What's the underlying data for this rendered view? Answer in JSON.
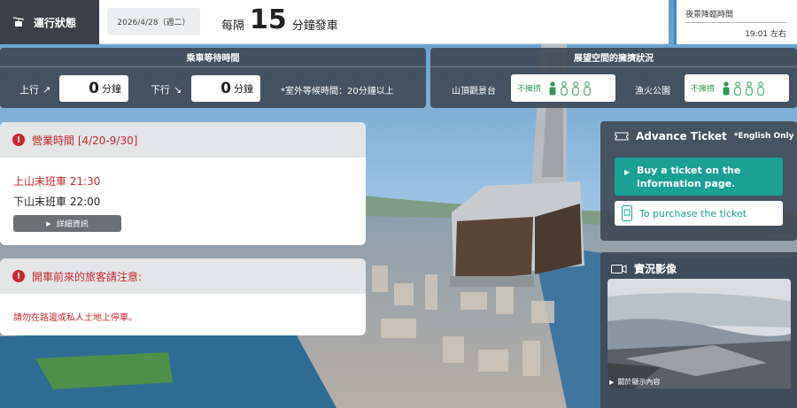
{
  "status": {
    "tag_label": "運行狀態",
    "date": "2026/4/28（週二）",
    "interval_prefix": "每隔",
    "interval_value": "15",
    "interval_suffix": "分鐘發車"
  },
  "night_view": {
    "label": "夜景降臨時間",
    "time": "19:01 左右"
  },
  "wait_time": {
    "title": "乘車等待時間",
    "up_label": "上行",
    "up_value": "0",
    "down_label": "下行",
    "down_value": "0",
    "unit": "分鐘",
    "outdoor_note": "*室外等候時間：20分鐘以上"
  },
  "crowd": {
    "title": "展望空間的擁擠狀況",
    "items": [
      {
        "place": "山頂觀景台",
        "status": "不擁擠",
        "level": 1,
        "max": 4
      },
      {
        "place": "漁火公園",
        "status": "不擁擠",
        "level": 1,
        "max": 4
      }
    ]
  },
  "hours": {
    "title": "營業時間 [4/20-9/30]",
    "up_last": "上山末班車 21:30",
    "down_last": "下山末班車 22:00",
    "detail_button": "詳細資訊"
  },
  "notice": {
    "title": "開車前來的旅客請注意:",
    "body": "請勿在路邊或私人土地上停車。"
  },
  "ticket": {
    "title": "Advance Ticket",
    "english_only": "*English Only",
    "buy_button": "Buy a ticket on the information page.",
    "purchase_link": "To purchase the ticket"
  },
  "live": {
    "title": "實況影像",
    "caption": "關於顯示內容"
  },
  "colors": {
    "accent_red": "#c8282e",
    "teal": "#1aa095",
    "crowd_green": "#2e9a57",
    "panel_dark": "#3e4854",
    "night_border": "#3b88d1"
  },
  "icons": [
    "ropeway-icon",
    "arrow-up-right-icon",
    "arrow-down-right-icon",
    "person-icon",
    "warning-icon",
    "ticket-icon",
    "qr-phone-icon",
    "camera-icon",
    "play-icon"
  ]
}
